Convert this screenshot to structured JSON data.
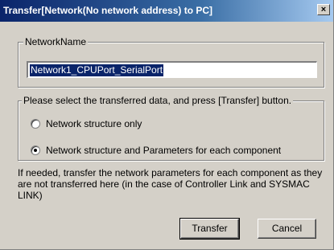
{
  "window": {
    "title": "Transfer[Network(No network address) to PC]",
    "close_glyph": "×"
  },
  "network_group": {
    "legend": "NetworkName",
    "input_value": "Network1_CPUPort_SerialPort"
  },
  "data_group": {
    "legend": "Please select the transferred data, and press [Transfer] button.",
    "options": [
      {
        "label": "Network structure only",
        "selected": false
      },
      {
        "label": "Network structure and Parameters for each component",
        "selected": true
      }
    ]
  },
  "info_text": "If needed, transfer the network parameters for each component as they are not transferred here (in the case of Controller Link and SYSMAC LINK)",
  "buttons": {
    "transfer": "Transfer",
    "cancel": "Cancel"
  },
  "colors": {
    "title_bar": "#0a246a",
    "selection": "#0a246a",
    "face": "#d4d0c8"
  }
}
